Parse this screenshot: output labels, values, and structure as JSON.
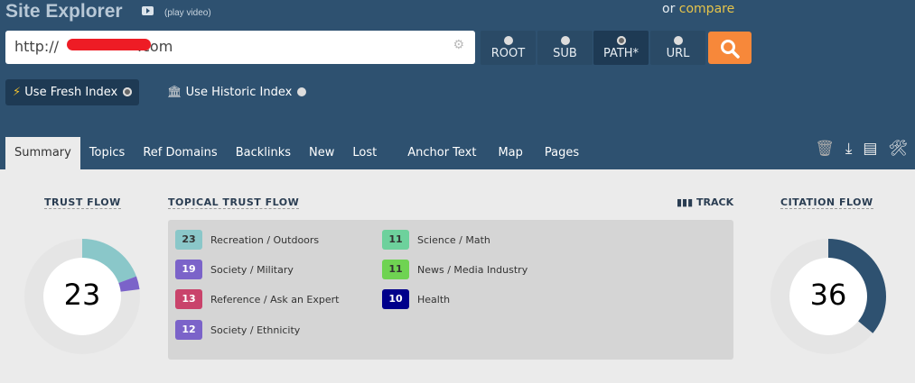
{
  "header": {
    "title": "Site Explorer",
    "play_video": "(play video)",
    "or": "or",
    "compare": "compare"
  },
  "search": {
    "url_prefix": "http://",
    "url_suffix": ".com",
    "scopes": [
      {
        "label": "ROOT",
        "selected": false
      },
      {
        "label": "SUB",
        "selected": false
      },
      {
        "label": "PATH*",
        "selected": true
      },
      {
        "label": "URL",
        "selected": false
      }
    ]
  },
  "index": {
    "fresh": "Use Fresh Index",
    "historic": "Use Historic Index",
    "selected": "fresh"
  },
  "tabs": [
    "Summary",
    "Topics",
    "Ref Domains",
    "Backlinks",
    "New",
    "Lost",
    "Anchor Text",
    "Map",
    "Pages"
  ],
  "active_tab": "Summary",
  "summary": {
    "trust_flow_label": "TRUST FLOW",
    "trust_flow": "23",
    "topical_label": "TOPICAL TRUST FLOW",
    "track": "TRACK",
    "citation_flow_label": "CITATION FLOW",
    "citation_flow": "36",
    "topics": [
      {
        "value": "23",
        "label": "Recreation / Outdoors",
        "color": "#8ac7c9",
        "text_color": "#333"
      },
      {
        "value": "19",
        "label": "Society / Military",
        "color": "#7b63c9",
        "text_color": "#fff"
      },
      {
        "value": "13",
        "label": "Reference / Ask an Expert",
        "color": "#c9436b",
        "text_color": "#fff"
      },
      {
        "value": "12",
        "label": "Society / Ethnicity",
        "color": "#7b63c9",
        "text_color": "#fff"
      },
      {
        "value": "11",
        "label": "Science / Math",
        "color": "#6dd19c",
        "text_color": "#333"
      },
      {
        "value": "11",
        "label": "News / Media Industry",
        "color": "#6fd352",
        "text_color": "#333"
      },
      {
        "value": "10",
        "label": "Health",
        "color": "#00008b",
        "text_color": "#fff"
      }
    ]
  }
}
